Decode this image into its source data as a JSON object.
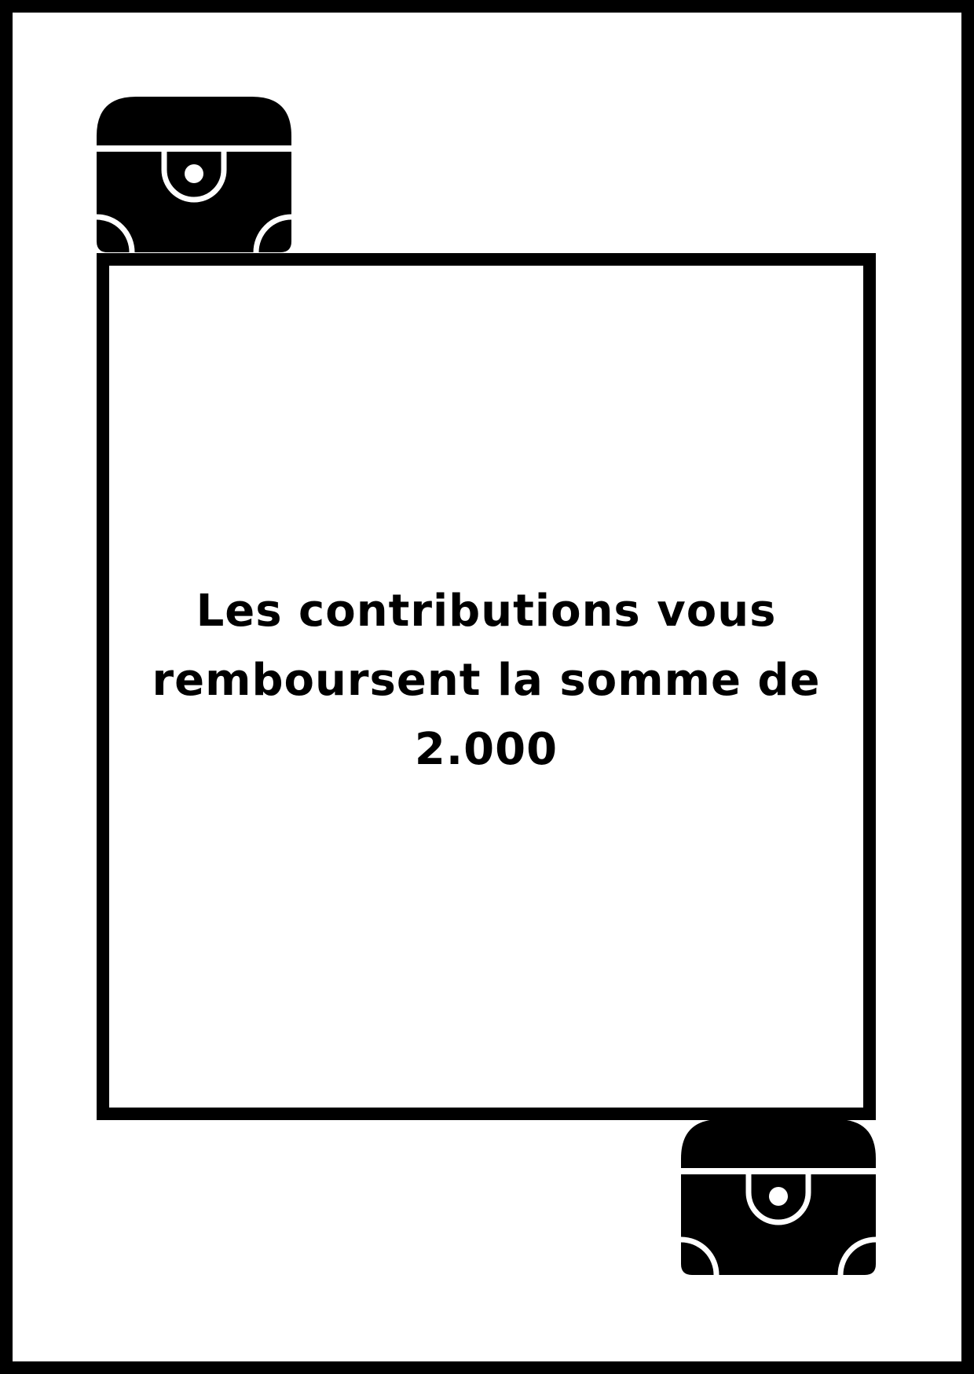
{
  "card": {
    "message": "Les contributions vous remboursent la somme de 2.000"
  },
  "icons": {
    "top_left": "treasure-chest-icon",
    "bottom_right": "treasure-chest-icon"
  },
  "colors": {
    "ink": "#000000",
    "paper": "#ffffff"
  }
}
